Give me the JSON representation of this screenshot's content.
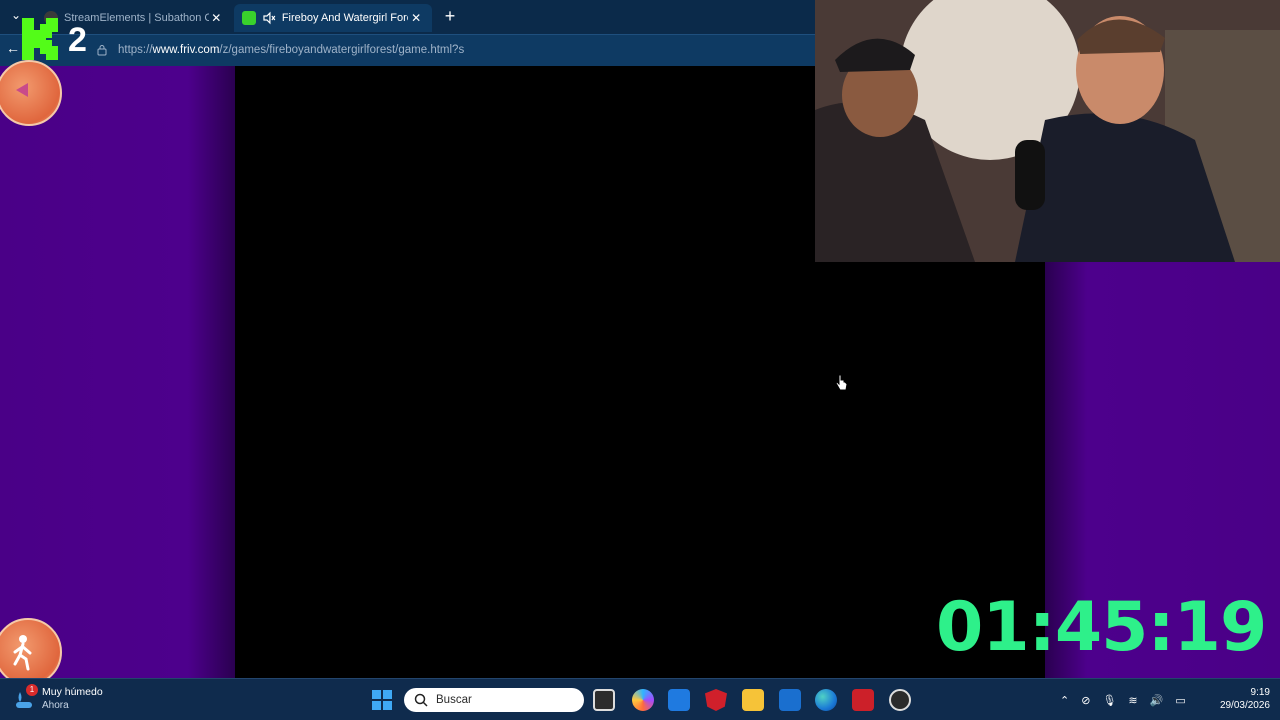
{
  "browser": {
    "tabs": [
      {
        "label": "StreamElements | Subathon Count",
        "active": false
      },
      {
        "label": "Fireboy And Watergirl Forest",
        "active": true
      }
    ],
    "url_prefix": "https://",
    "url_host": "www.friv.com",
    "url_path": "/z/games/fireboyandwatergirlforest/game.html?s"
  },
  "overlay": {
    "kick_count": "2",
    "timer": "01:45:19",
    "timer_color": "#2ef08a"
  },
  "game": {
    "side_color": "#4a0087",
    "button_color": "#e0663d"
  },
  "taskbar": {
    "weather_title": "Muy húmedo",
    "weather_sub": "Ahora",
    "weather_badge": "1",
    "search_placeholder": "Buscar",
    "apps": [
      "file-explorer-icon",
      "copilot-icon",
      "store-icon",
      "mcafee-icon",
      "folder-icon",
      "outlook-icon",
      "edge-icon",
      "lastpass-icon",
      "obs-icon"
    ],
    "clock_time": "9:19",
    "clock_date": "29/03/2026"
  }
}
